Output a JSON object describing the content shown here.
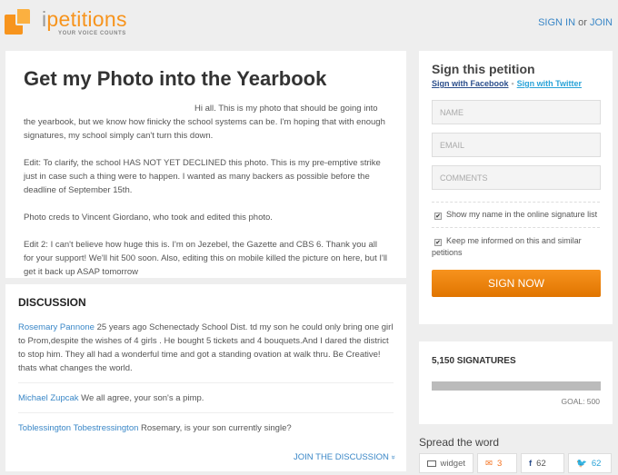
{
  "header": {
    "logo_prefix": "i",
    "logo_name": "petitions",
    "logo_tagline": "YOUR VOICE COUNTS",
    "sign_in": "SIGN IN",
    "or": "or",
    "join": "JOIN"
  },
  "petition": {
    "title": "Get my Photo into the Yearbook",
    "paragraphs": [
      "Hi all. This is my photo that should be going into the yearbook, but we know how finicky the school systems can be. I'm hoping that with enough signatures, my school simply can't turn this down.",
      "Edit: To clarify, the school HAS NOT YET DECLINED this photo. This is my pre-emptive strike just in case such a thing were to happen. I wanted as many backers as possible before the deadline of September 15th.",
      "Photo creds to Vincent Giordano, who took and edited this photo.",
      "Edit 2: I can't believe how huge this is. I'm on Jezebel, the Gazette and CBS 6. Thank you all for your support! We'll hit 500 soon. Also, editing this on mobile killed the picture on here, but I'll get it back up ASAP tomorrow"
    ]
  },
  "discussion": {
    "heading": "DISCUSSION",
    "comments": [
      {
        "author": "Rosemary Pannone",
        "text": "25 years ago Schenectady School Dist. td my son he could only bring one girl to Prom,despite the wishes of 4 girls . He bought 5 tickets and 4 bouquets.And I dared the district to stop him. They all had a wonderful time and got a standing ovation at walk thru. Be Creative! thats what changes the world."
      },
      {
        "author": "Michael Zupcak",
        "text": "We all agree, your son's a pimp."
      },
      {
        "author": "Toblessington Tobestressington",
        "text": "Rosemary, is your son currently single?"
      }
    ],
    "join_label": "JOIN THE DISCUSSION",
    "join_icon": "»"
  },
  "sign_form": {
    "heading": "Sign this petition",
    "facebook_link": "Sign with Facebook",
    "twitter_link": "Sign with Twitter",
    "name_placeholder": "NAME",
    "email_placeholder": "EMAIL",
    "comments_placeholder": "COMMENTS",
    "show_name_label": "Show my name in the online signature list",
    "show_name_checked": true,
    "keep_informed_label": "Keep me informed on this and similar petitions",
    "keep_informed_checked": true,
    "submit_label": "SIGN NOW"
  },
  "signatures": {
    "count_label": "5,150 SIGNATURES",
    "progress_percent": 100,
    "goal_label": "GOAL: 500"
  },
  "share": {
    "heading": "Spread the word",
    "widget_label": "widget",
    "email_count": "3",
    "facebook_count": "62",
    "twitter_count": "62"
  }
}
